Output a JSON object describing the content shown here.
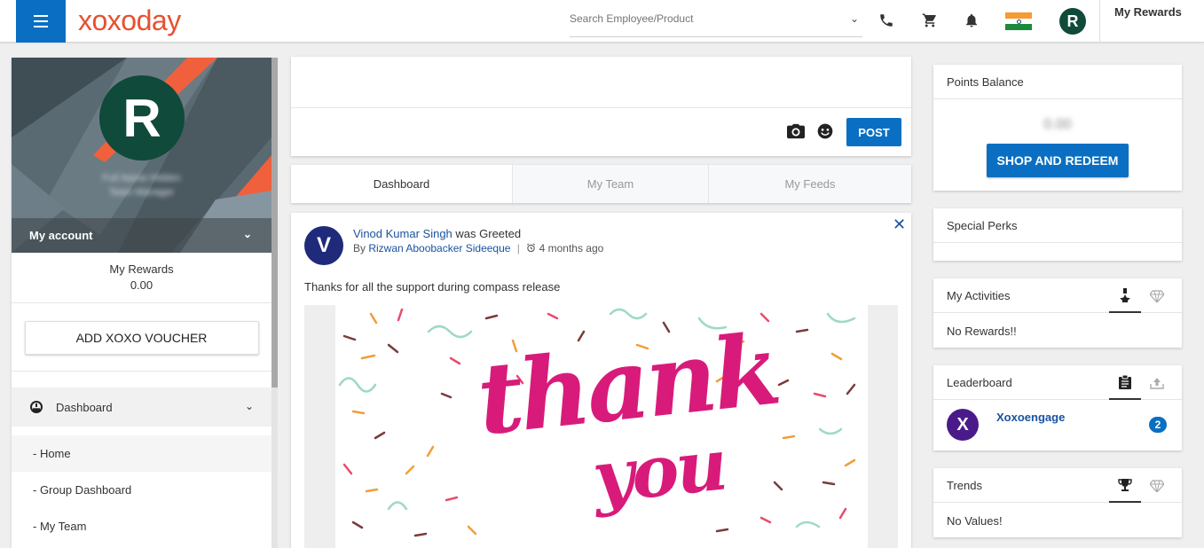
{
  "header": {
    "logo": "xoxoday",
    "search_placeholder": "Search Employee/Product",
    "my_rewards": "My Rewards",
    "avatar_initial": "R",
    "icons": [
      "menu-icon",
      "phone-icon",
      "cart-icon",
      "bell-icon",
      "india-flag-icon",
      "chevron-down-icon"
    ]
  },
  "sidebar": {
    "avatar_initial": "R",
    "user_name_blurred": "Full Name Hidden",
    "user_title_blurred": "Team Manager",
    "my_account": "My account",
    "rewards_title": "My Rewards",
    "rewards_value": "0.00",
    "voucher_button": "ADD XOXO VOUCHER",
    "nav_section": "Dashboard",
    "nav_items": [
      "- Home",
      "- Group Dashboard",
      "- My Team"
    ]
  },
  "composer": {
    "post_button": "POST"
  },
  "tabs": [
    "Dashboard",
    "My Team",
    "My Feeds"
  ],
  "feed": {
    "avatar_initial": "V",
    "author": "Vinod Kumar Singh",
    "action": " was Greeted",
    "by_label": "By ",
    "by_name": "Rizwan Aboobacker Sideeque",
    "separator": "|",
    "time": "4 months ago",
    "message": "Thanks for all the support during compass release",
    "image_line1": "thank",
    "image_line2": "you"
  },
  "right": {
    "points_title": "Points Balance",
    "points_value": "0.00",
    "shop_button": "SHOP AND REDEEM",
    "perks_title": "Special Perks",
    "activities_title": "My Activities",
    "activities_empty": "No Rewards!!",
    "leaderboard_title": "Leaderboard",
    "leader_initial": "X",
    "leader_name": "Xoxoengage",
    "leader_count": "2",
    "trends_title": "Trends",
    "trends_empty": "No Values!"
  },
  "colors": {
    "primary": "#0a6fc2",
    "logo": "#e8502f",
    "avatar_green": "#0f4a3a",
    "link": "#1a52a0",
    "thank_you_pink": "#d81b7a"
  }
}
